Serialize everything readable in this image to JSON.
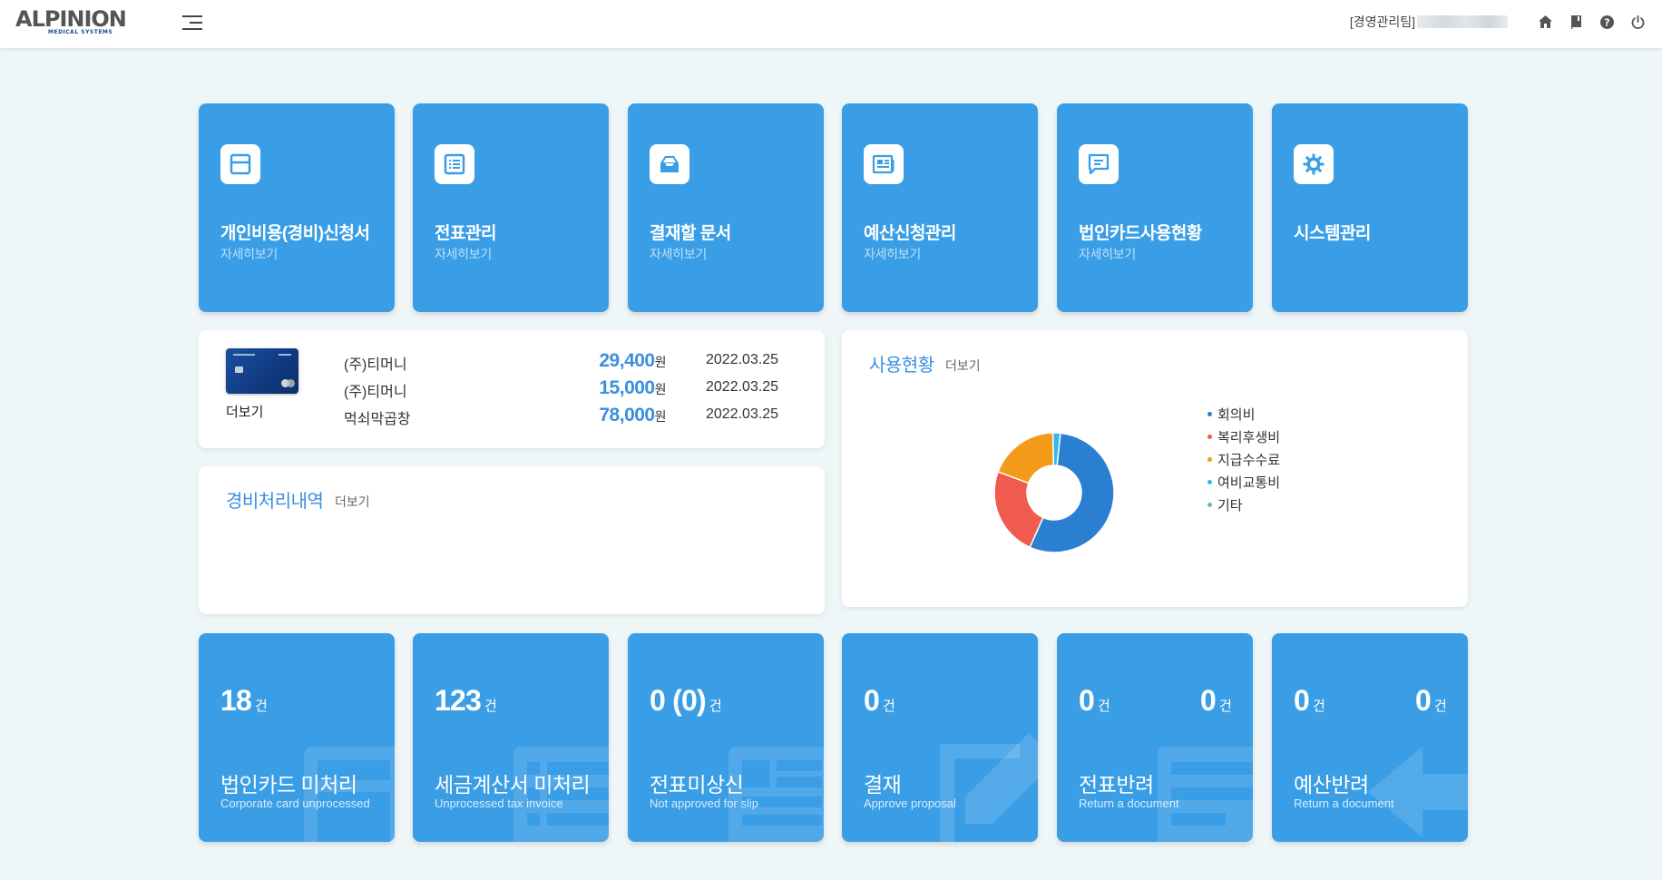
{
  "header": {
    "logo_text": "ALPINION",
    "logo_subtext": "MEDICAL SYSTEMS",
    "team_label": "[경영관리팀]",
    "icons": [
      "home-icon",
      "book-icon",
      "help-icon",
      "power-icon"
    ]
  },
  "menu_cards": [
    {
      "title": "개인비용(경비)신청서",
      "sub": "자세히보기",
      "icon": "card-icon"
    },
    {
      "title": "전표관리",
      "sub": "자세히보기",
      "icon": "list-icon"
    },
    {
      "title": "결재할 문서",
      "sub": "자세히보기",
      "icon": "inbox-icon"
    },
    {
      "title": "예산신청관리",
      "sub": "자세히보기",
      "icon": "newspaper-icon"
    },
    {
      "title": "법인카드사용현황",
      "sub": "자세히보기",
      "icon": "message-icon"
    },
    {
      "title": "시스템관리",
      "sub": "",
      "icon": "gear-icon"
    }
  ],
  "card_panel": {
    "more_label": "더보기",
    "transactions": [
      {
        "merchant": "(주)티머니",
        "amount": "29,400",
        "unit": "원",
        "date": "2022.03.25"
      },
      {
        "merchant": "(주)티머니",
        "amount": "15,000",
        "unit": "원",
        "date": "2022.03.25"
      },
      {
        "merchant": "먹쇠막곱창",
        "amount": "78,000",
        "unit": "원",
        "date": "2022.03.25"
      }
    ]
  },
  "expense_panel": {
    "title": "경비처리내역",
    "more_label": "더보기"
  },
  "usage_panel": {
    "title": "사용현황",
    "more_label": "더보기"
  },
  "chart_data": {
    "type": "pie",
    "donut": true,
    "categories": [
      "회의비",
      "복리후생비",
      "지급수수료",
      "여비교통비",
      "기타"
    ],
    "values": [
      55,
      24,
      19,
      2,
      0
    ],
    "colors": [
      "#2b7fd0",
      "#ef5b4f",
      "#f39a1a",
      "#34b8ec",
      "#5cc88a"
    ],
    "legend_position": "right"
  },
  "stat_cards": [
    {
      "values": [
        "18"
      ],
      "unit": "건",
      "title": "법인카드 미처리",
      "sub": "Corporate card unprocessed",
      "icon": "card-watermark-icon"
    },
    {
      "values": [
        "123"
      ],
      "unit": "건",
      "title": "세금계산서 미처리",
      "sub": "Unprocessed tax invoice",
      "icon": "invoice-watermark-icon"
    },
    {
      "values": [
        "0 (0)"
      ],
      "unit": "건",
      "title": "전표미상신",
      "sub": "Not approved for slip",
      "icon": "slip-watermark-icon"
    },
    {
      "values": [
        "0"
      ],
      "unit": "건",
      "title": "결재",
      "sub": "Approve proposal",
      "icon": "edit-watermark-icon"
    },
    {
      "values": [
        "0",
        "0"
      ],
      "unit": "건",
      "title": "전표반려",
      "sub": "Return a document",
      "icon": "return-doc-watermark-icon"
    },
    {
      "values": [
        "0",
        "0"
      ],
      "unit": "건",
      "title": "예산반려",
      "sub": "Return a document",
      "icon": "return-arrow-watermark-icon"
    }
  ]
}
